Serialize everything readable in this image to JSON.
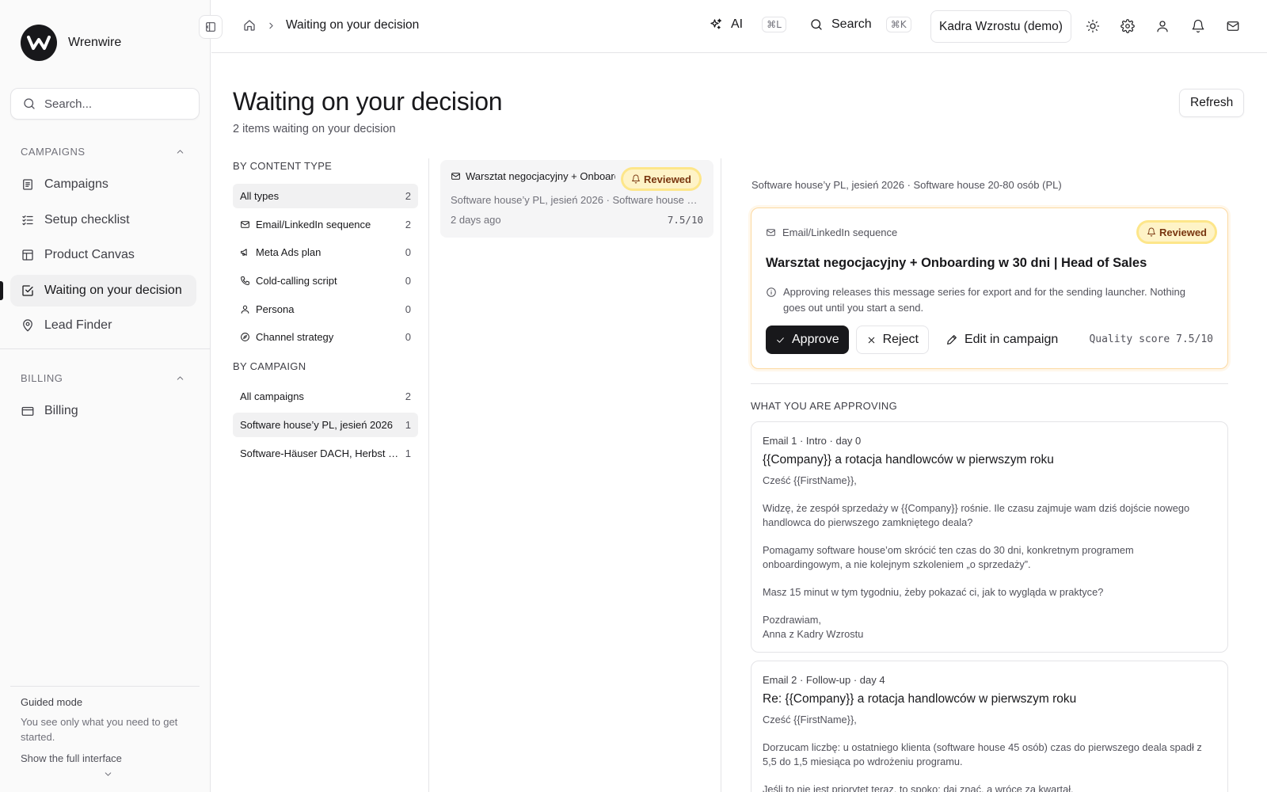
{
  "brand": {
    "name": "Wrenwire"
  },
  "sidebar": {
    "search_placeholder": "Search...",
    "sections": [
      {
        "title": "CAMPAIGNS",
        "items": [
          {
            "label": "Campaigns",
            "icon": "list-icon"
          },
          {
            "label": "Setup checklist",
            "icon": "checklist-icon"
          },
          {
            "label": "Product Canvas",
            "icon": "layout-icon"
          },
          {
            "label": "Waiting on your decision",
            "icon": "check-square-icon",
            "active": true
          },
          {
            "label": "Lead Finder",
            "icon": "map-pin-icon"
          }
        ]
      },
      {
        "title": "BILLING",
        "items": [
          {
            "label": "Billing",
            "icon": "credit-card-icon"
          }
        ]
      }
    ],
    "guided": {
      "title": "Guided mode",
      "text": "You see only what you need to get started.",
      "link": "Show the full interface"
    }
  },
  "topbar": {
    "breadcrumb": "Waiting on your decision",
    "ai_label": "AI",
    "ai_shortcut": "⌘L",
    "search_label": "Search",
    "search_shortcut": "⌘K",
    "workspace": "Kadra Wzrostu (demo)"
  },
  "page": {
    "title": "Waiting on your decision",
    "subtitle": "2 items waiting on your decision",
    "refresh_label": "Refresh"
  },
  "filters": {
    "by_type_title": "BY CONTENT TYPE",
    "types": [
      {
        "label": "All types",
        "count": "2",
        "selected": true,
        "icon": ""
      },
      {
        "label": "Email/LinkedIn sequence",
        "count": "2",
        "icon": "mail-icon"
      },
      {
        "label": "Meta Ads plan",
        "count": "0",
        "icon": "megaphone-icon"
      },
      {
        "label": "Cold-calling script",
        "count": "0",
        "icon": "phone-icon"
      },
      {
        "label": "Persona",
        "count": "0",
        "icon": "user-icon"
      },
      {
        "label": "Channel strategy",
        "count": "0",
        "icon": "compass-icon"
      }
    ],
    "by_campaign_title": "BY CAMPAIGN",
    "campaigns": [
      {
        "label": "All campaigns",
        "count": "2"
      },
      {
        "label": "Software house’y PL, jesień 2026",
        "count": "1",
        "selected": true
      },
      {
        "label": "Software-Häuser DACH, Herbst 2026",
        "count": "1"
      }
    ]
  },
  "queue": [
    {
      "title": "Warsztat negocjacyjny + Onboarding w 30 dni | Head of Sales",
      "badge": "Reviewed",
      "meta": "Software house’y PL, jesień 2026 · Software house 20-80 osób (PL)",
      "age": "2 days ago",
      "score": "7.5/10"
    }
  ],
  "detail": {
    "crumb": "Software house’y PL, jesień 2026 · Software house 20-80 osób (PL)",
    "type": "Email/LinkedIn sequence",
    "badge": "Reviewed",
    "title": "Warsztat negocjacyjny + Onboarding w 30 dni | Head of Sales",
    "info": "Approving releases this message series for export and for the sending launcher. Nothing goes out until you start a send.",
    "approve": "Approve",
    "reject": "Reject",
    "edit": "Edit in campaign",
    "quality": "Quality score 7.5/10",
    "approving_title": "WHAT YOU ARE APPROVING",
    "emails": [
      {
        "head": "Email 1 · Intro · day 0",
        "subject": "{{Company}} a rotacja handlowców w pierwszym roku",
        "body": "Cześć {{FirstName}},\n\nWidzę, że zespół sprzedaży w {{Company}} rośnie. Ile czasu zajmuje wam dziś dojście nowego handlowca do pierwszego zamkniętego deala?\n\nPomagamy software house’om skrócić ten czas do 30 dni, konkretnym programem onboardingowym, a nie kolejnym szkoleniem „o sprzedaży”.\n\nMasz 15 minut w tym tygodniu, żeby pokazać ci, jak to wygląda w praktyce?\n\nPozdrawiam,\nAnna z Kadry Wzrostu"
      },
      {
        "head": "Email 2 · Follow-up · day 4",
        "subject": "Re: {{Company}} a rotacja handlowców w pierwszym roku",
        "body": "Cześć {{FirstName}},\n\nDorzucam liczbę: u ostatniego klienta (software house 45 osób) czas do pierwszego deala spadł z 5,5 do 1,5 miesiąca po wdrożeniu programu.\n\nJeśli to nie jest priorytet teraz, to spoko: daj znać, a wrócę za kwartał."
      }
    ]
  }
}
